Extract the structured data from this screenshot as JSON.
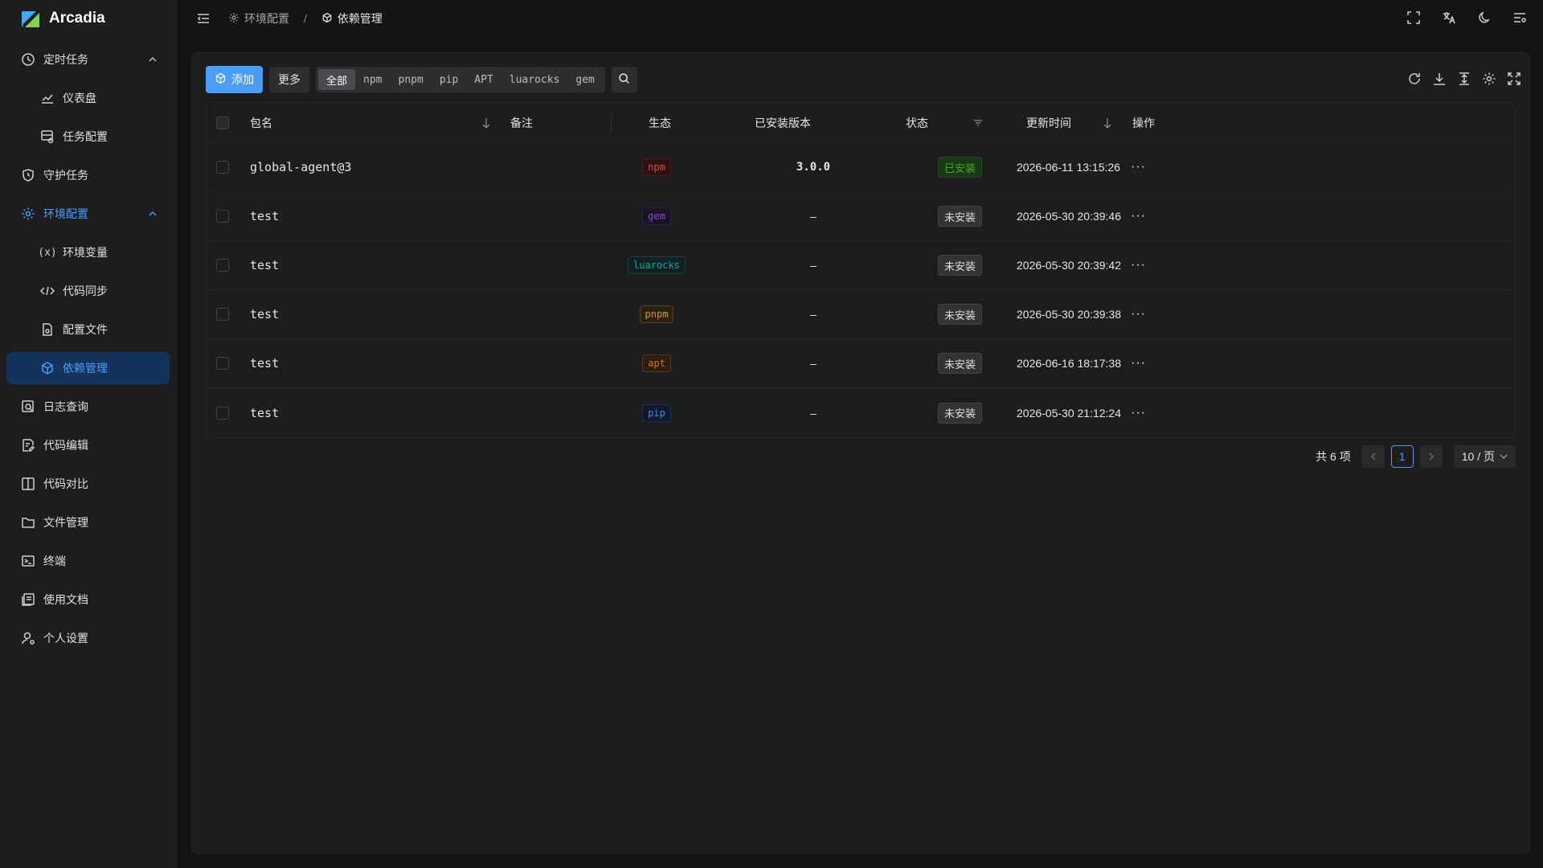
{
  "app": {
    "name": "Arcadia"
  },
  "sidebar": {
    "items": [
      {
        "label": "定时任务",
        "icon": "clock-icon",
        "expanded": true
      },
      {
        "label": "仪表盘",
        "icon": "chart-line-icon",
        "sub": true
      },
      {
        "label": "任务配置",
        "icon": "task-config-icon",
        "sub": true
      },
      {
        "label": "守护任务",
        "icon": "shield-clock-icon"
      },
      {
        "label": "环境配置",
        "icon": "gear-icon",
        "expanded": true
      },
      {
        "label": "环境变量",
        "icon": "variable-icon",
        "sub": true
      },
      {
        "label": "代码同步",
        "icon": "code-sync-icon",
        "sub": true
      },
      {
        "label": "配置文件",
        "icon": "config-file-icon",
        "sub": true
      },
      {
        "label": "依赖管理",
        "icon": "package-icon",
        "sub": true,
        "active": true
      },
      {
        "label": "日志查询",
        "icon": "log-search-icon"
      },
      {
        "label": "代码编辑",
        "icon": "code-edit-icon"
      },
      {
        "label": "代码对比",
        "icon": "diff-icon"
      },
      {
        "label": "文件管理",
        "icon": "folder-icon"
      },
      {
        "label": "终端",
        "icon": "terminal-icon"
      },
      {
        "label": "使用文档",
        "icon": "docs-icon"
      },
      {
        "label": "个人设置",
        "icon": "user-settings-icon"
      }
    ]
  },
  "breadcrumb": {
    "parent": "环境配置",
    "current": "依赖管理",
    "separator": "/"
  },
  "toolbar": {
    "add_label": "添加",
    "more_label": "更多",
    "filters": [
      "全部",
      "npm",
      "pnpm",
      "pip",
      "APT",
      "luarocks",
      "gem"
    ],
    "selected_filter": "全部"
  },
  "table": {
    "headers": {
      "name": "包名",
      "remark": "备注",
      "ecosystem": "生态",
      "version": "已安装版本",
      "status": "状态",
      "updated": "更新时间",
      "actions": "操作"
    },
    "rows": [
      {
        "name": "global-agent@3",
        "remark": "",
        "ecosystem": "npm",
        "version": "3.0.0",
        "status": "已安装",
        "installed": true,
        "updated": "2026-06-11 13:15:26",
        "action": "···"
      },
      {
        "name": "test",
        "remark": "",
        "ecosystem": "gem",
        "version": "–",
        "status": "未安装",
        "installed": false,
        "updated": "2026-05-30 20:39:46",
        "action": "···"
      },
      {
        "name": "test",
        "remark": "",
        "ecosystem": "luarocks",
        "version": "–",
        "status": "未安装",
        "installed": false,
        "updated": "2026-05-30 20:39:42",
        "action": "···"
      },
      {
        "name": "test",
        "remark": "",
        "ecosystem": "pnpm",
        "version": "–",
        "status": "未安装",
        "installed": false,
        "updated": "2026-05-30 20:39:38",
        "action": "···"
      },
      {
        "name": "test",
        "remark": "",
        "ecosystem": "apt",
        "version": "–",
        "status": "未安装",
        "installed": false,
        "updated": "2026-06-16 18:17:38",
        "action": "···"
      },
      {
        "name": "test",
        "remark": "",
        "ecosystem": "pip",
        "version": "–",
        "status": "未安装",
        "installed": false,
        "updated": "2026-05-30 21:12:24",
        "action": "···"
      }
    ]
  },
  "tag_colors": {
    "npm": {
      "fg": "#e84749",
      "bg": "#2a1215",
      "border": "#58181c"
    },
    "gem": {
      "fg": "#854eca",
      "bg": "#1a1325",
      "border": "#301c4d"
    },
    "luarocks": {
      "fg": "#13a8a8",
      "bg": "#112123",
      "border": "#144848"
    },
    "pnpm": {
      "fg": "#d89614",
      "bg": "#2b2111",
      "border": "#594214"
    },
    "apt": {
      "fg": "#d87a16",
      "bg": "#2b1d11",
      "border": "#593815"
    },
    "pip": {
      "fg": "#3c89e8",
      "bg": "#111a2c",
      "border": "#15325b"
    }
  },
  "pagination": {
    "total": "共 6 项",
    "current_page": "1",
    "page_size": "10 / 页"
  },
  "colors": {
    "accent": "#4a9df8",
    "background": "#141414",
    "surface": "#1d1d1f"
  }
}
